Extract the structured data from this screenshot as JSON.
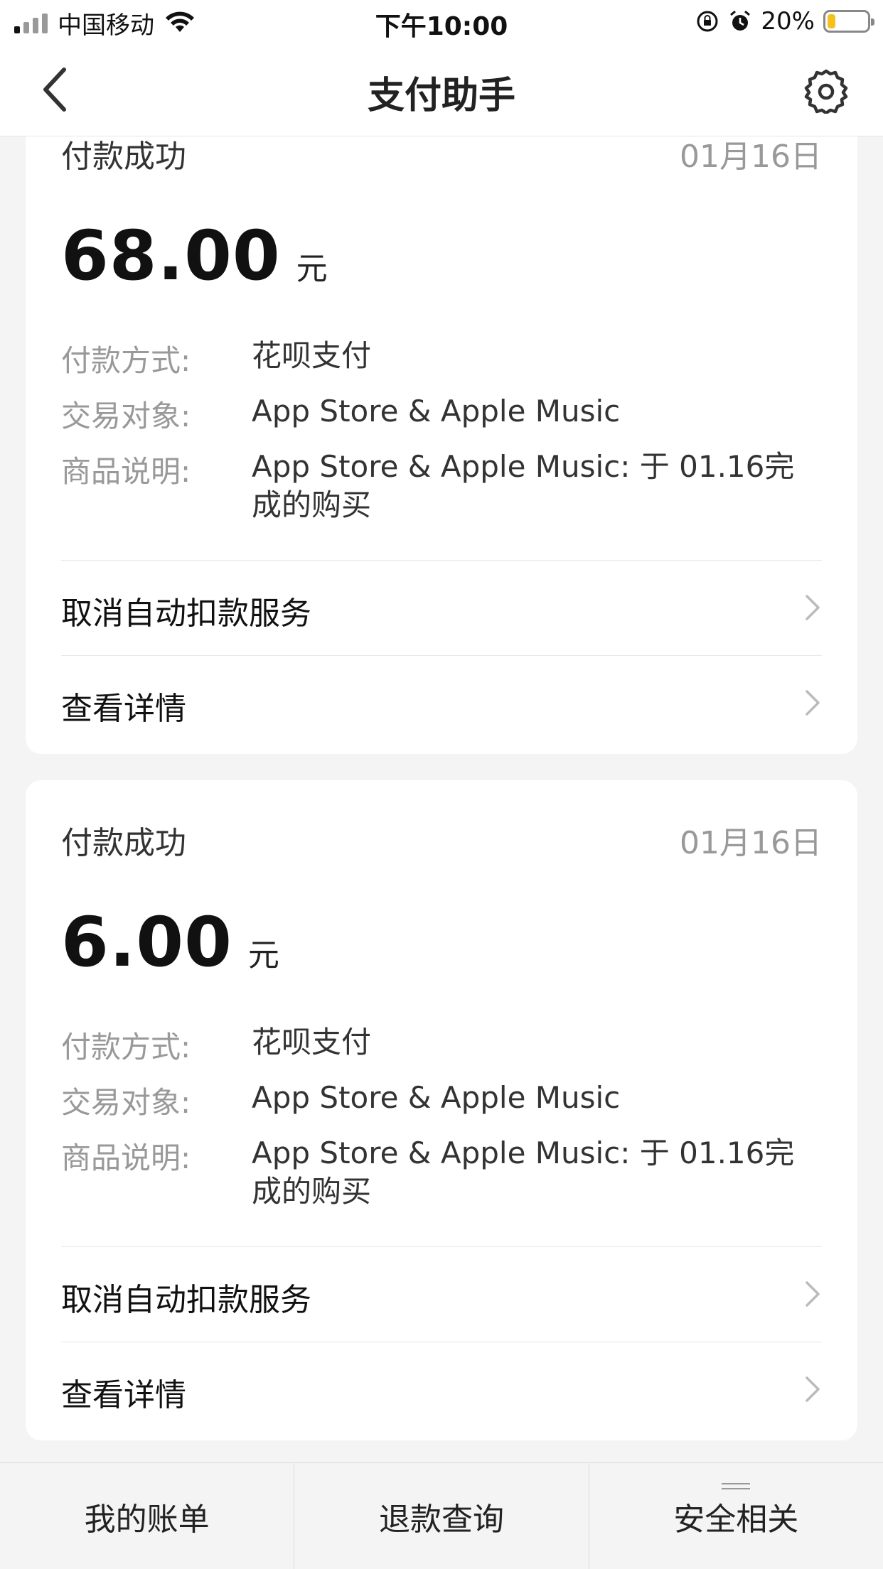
{
  "status_bar": {
    "carrier": "中国移动",
    "time": "下午10:00",
    "battery_pct": "20%",
    "battery_level": 0.2,
    "battery_color": "#f4c11f"
  },
  "nav": {
    "title": "支付助手",
    "back_icon": "chevron-left-icon",
    "settings_icon": "gear-icon"
  },
  "cards": [
    {
      "status": "付款成功",
      "date": "01月16日",
      "amount": "68.00",
      "unit": "元",
      "method_label": "付款方式:",
      "method_value": "花呗支付",
      "counterparty_label": "交易对象:",
      "counterparty_value": "App Store & Apple Music",
      "desc_label": "商品说明:",
      "desc_value": "App Store & Apple Music: 于 01.16完成的购买",
      "action_cancel": "取消自动扣款服务",
      "action_details": "查看详情"
    },
    {
      "status": "付款成功",
      "date": "01月16日",
      "amount": "6.00",
      "unit": "元",
      "method_label": "付款方式:",
      "method_value": "花呗支付",
      "counterparty_label": "交易对象:",
      "counterparty_value": "App Store & Apple Music",
      "desc_label": "商品说明:",
      "desc_value": "App Store & Apple Music: 于 01.16完成的购买",
      "action_cancel": "取消自动扣款服务",
      "action_details": "查看详情"
    }
  ],
  "tab_bar": {
    "tabs": [
      "我的账单",
      "退款查询",
      "安全相关"
    ]
  }
}
